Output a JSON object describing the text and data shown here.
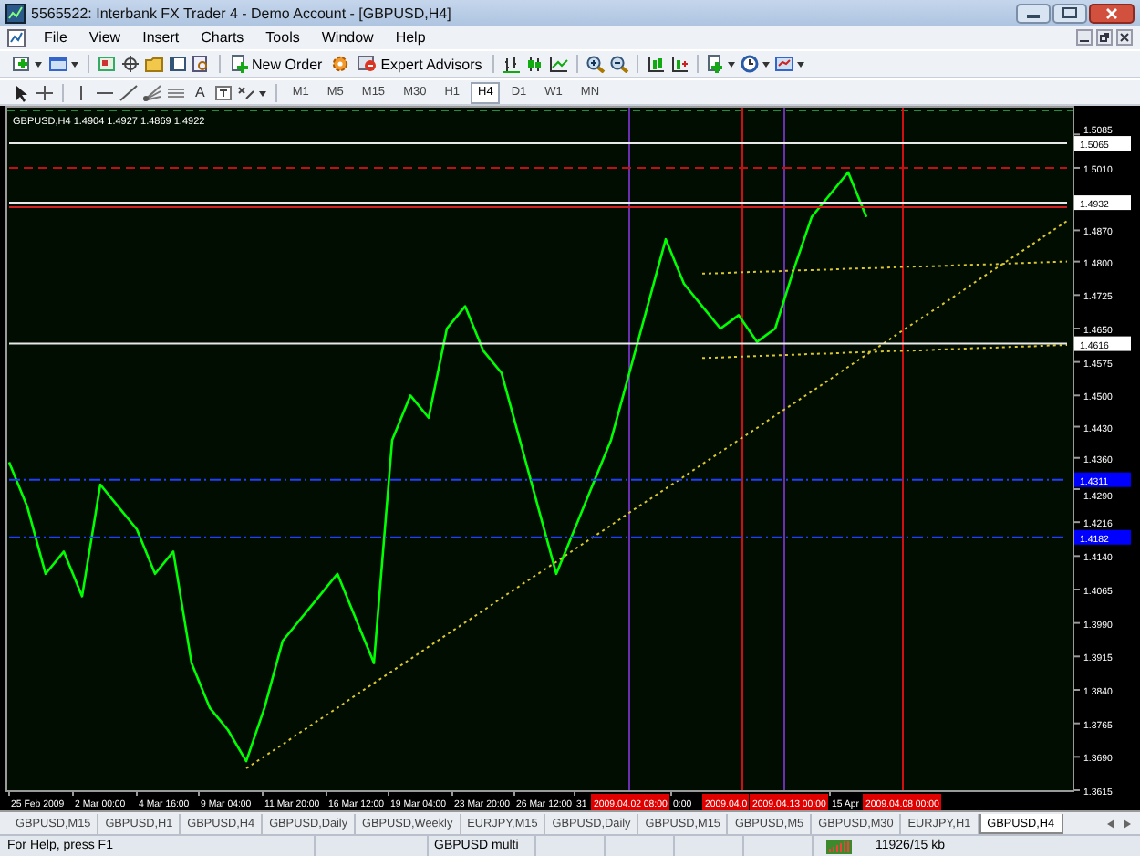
{
  "window": {
    "title": "5565522: Interbank FX Trader 4 - Demo Account - [GBPUSD,H4]"
  },
  "menu": [
    "File",
    "View",
    "Insert",
    "Charts",
    "Tools",
    "Window",
    "Help"
  ],
  "toolbar": {
    "new_order": "New Order",
    "expert_advisors": "Expert Advisors",
    "text_tool": "A"
  },
  "timeframes": [
    {
      "label": "M1",
      "selected": false
    },
    {
      "label": "M5",
      "selected": false
    },
    {
      "label": "M15",
      "selected": false
    },
    {
      "label": "M30",
      "selected": false
    },
    {
      "label": "H1",
      "selected": false
    },
    {
      "label": "H4",
      "selected": true
    },
    {
      "label": "D1",
      "selected": false
    },
    {
      "label": "W1",
      "selected": false
    },
    {
      "label": "MN",
      "selected": false
    }
  ],
  "chart": {
    "quote": "1.4904 1.4927 1.4869 1.4922",
    "price_markers": [
      {
        "label": "1.5065",
        "color": "#ffffff"
      },
      {
        "label": "1.4932",
        "color": "#ffffff"
      },
      {
        "label": "1.4616",
        "color": "#ffffff"
      },
      {
        "label": "1.4311",
        "color": "#0000ff"
      },
      {
        "label": "1.4182",
        "color": "#0000ff"
      }
    ],
    "time_axis": [
      "25 Feb 2009",
      "2 Mar 00:00",
      "4 Mar 16:00",
      "9 Mar 04:00",
      "11 Mar 20:00",
      "16 Mar 12:00",
      "19 Mar 04:00",
      "23 Mar 20:00",
      "26 Mar 12:00",
      "31",
      "0:00",
      "15 Apr"
    ],
    "time_markers": [
      "2009.04.02 08:00",
      "2009.04.0",
      "2009.04.13 00:00",
      "2009.04.08 00:00"
    ],
    "chart_data": {
      "type": "line",
      "ylim": [
        1.3615,
        1.5149
      ],
      "series": [
        {
          "name": "GBPUSD,H4",
          "color": "#00ff00",
          "values": [
            1.435,
            1.425,
            1.41,
            1.415,
            1.405,
            1.43,
            1.425,
            1.42,
            1.41,
            1.415,
            1.39,
            1.38,
            1.375,
            1.368,
            1.38,
            1.395,
            1.4,
            1.405,
            1.41,
            1.4,
            1.39,
            1.44,
            1.45,
            1.445,
            1.465,
            1.47,
            1.46,
            1.455,
            1.44,
            1.425,
            1.41,
            1.42,
            1.43,
            1.44,
            1.455,
            1.47,
            1.485,
            1.475,
            1.47,
            1.465,
            1.468,
            1.462,
            1.465,
            1.478,
            1.49,
            1.495,
            1.5,
            1.49
          ]
        },
        {
          "color": "#d9c631",
          "line_style": "dotted",
          "values": [
            null,
            null,
            null,
            null,
            null,
            null,
            null,
            null,
            null,
            null,
            null,
            null,
            null,
            1.3664,
            1.3691,
            1.3718,
            1.3746,
            1.3773,
            1.38,
            1.3828,
            1.3855,
            1.3882,
            1.3909,
            1.3937,
            1.3964,
            1.3991,
            1.4018,
            1.4046,
            1.4073,
            1.41,
            1.4127,
            1.4155,
            1.4182,
            1.4209,
            1.4237,
            1.4264,
            1.4291,
            1.4318,
            1.4346,
            1.4373,
            1.44,
            1.4427,
            1.4455,
            1.4482,
            1.4509,
            1.4536,
            1.4564,
            1.4591,
            1.4618,
            1.4646,
            1.4673,
            1.47,
            1.4727,
            1.4755,
            1.4782,
            1.4809,
            1.4836,
            1.4864,
            1.4891
          ]
        },
        {
          "color": "#d9c631",
          "line_style": "dotted",
          "values": [
            null,
            null,
            null,
            null,
            null,
            null,
            null,
            null,
            null,
            null,
            null,
            null,
            null,
            null,
            null,
            null,
            null,
            null,
            null,
            null,
            null,
            null,
            null,
            null,
            null,
            null,
            null,
            null,
            null,
            null,
            null,
            null,
            null,
            null,
            null,
            null,
            null,
            null,
            1.4773,
            1.4774,
            1.4776,
            1.4777,
            1.4778,
            1.478,
            1.4781,
            1.4782,
            1.4784,
            1.4785,
            1.4786,
            1.4788,
            1.4789,
            1.479,
            1.4792,
            1.4793,
            1.4794,
            1.4796,
            1.4797,
            1.4799,
            1.48
          ]
        },
        {
          "color": "#d9c631",
          "line_style": "dotted",
          "values": [
            null,
            null,
            null,
            null,
            null,
            null,
            null,
            null,
            null,
            null,
            null,
            null,
            null,
            null,
            null,
            null,
            null,
            null,
            null,
            null,
            null,
            null,
            null,
            null,
            null,
            null,
            null,
            null,
            null,
            null,
            null,
            null,
            null,
            null,
            null,
            null,
            null,
            null,
            1.4584,
            1.4585,
            1.4587,
            1.4588,
            1.459,
            1.4591,
            1.4593,
            1.4594,
            1.4596,
            1.4597,
            1.4599,
            1.46,
            1.4601,
            1.4603,
            1.4604,
            1.4606,
            1.4607,
            1.4609,
            1.461,
            1.4612,
            1.4613
          ]
        },
        {
          "color": "#e8e8e8",
          "line_style": "solid",
          "values": [
            1.5065,
            1.5065,
            1.5065,
            1.5065,
            1.5065,
            1.5065,
            1.5065,
            1.5065,
            1.5065,
            1.5065,
            1.5065,
            1.5065,
            1.5065,
            1.5065,
            1.5065,
            1.5065,
            1.5065,
            1.5065,
            1.5065,
            1.5065,
            1.5065,
            1.5065,
            1.5065,
            1.5065,
            1.5065,
            1.5065,
            1.5065,
            1.5065,
            1.5065,
            1.5065,
            1.5065,
            1.5065,
            1.5065,
            1.5065,
            1.5065,
            1.5065,
            1.5065,
            1.5065,
            1.5065,
            1.5065,
            1.5065,
            1.5065,
            1.5065,
            1.5065,
            1.5065,
            1.5065,
            1.5065,
            1.5065,
            1.5065,
            1.5065,
            1.5065,
            1.5065,
            1.5065,
            1.5065,
            1.5065,
            1.5065,
            1.5065,
            1.5065,
            1.5065
          ]
        },
        {
          "color": "#c01010",
          "line_style": "dashed",
          "values": [
            1.501,
            1.501,
            1.501,
            1.501,
            1.501,
            1.501,
            1.501,
            1.501,
            1.501,
            1.501,
            1.501,
            1.501,
            1.501,
            1.501,
            1.501,
            1.501,
            1.501,
            1.501,
            1.501,
            1.501,
            1.501,
            1.501,
            1.501,
            1.501,
            1.501,
            1.501,
            1.501,
            1.501,
            1.501,
            1.501,
            1.501,
            1.501,
            1.501,
            1.501,
            1.501,
            1.501,
            1.501,
            1.501,
            1.501,
            1.501,
            1.501,
            1.501,
            1.501,
            1.501,
            1.501,
            1.501,
            1.501,
            1.501,
            1.501,
            1.501,
            1.501,
            1.501,
            1.501,
            1.501,
            1.501,
            1.501,
            1.501,
            1.501,
            1.501
          ]
        },
        {
          "color": "#e8e8e8",
          "line_style": "solid",
          "values": [
            1.4932,
            1.4932,
            1.4932,
            1.4932,
            1.4932,
            1.4932,
            1.4932,
            1.4932,
            1.4932,
            1.4932,
            1.4932,
            1.4932,
            1.4932,
            1.4932,
            1.4932,
            1.4932,
            1.4932,
            1.4932,
            1.4932,
            1.4932,
            1.4932,
            1.4932,
            1.4932,
            1.4932,
            1.4932,
            1.4932,
            1.4932,
            1.4932,
            1.4932,
            1.4932,
            1.4932,
            1.4932,
            1.4932,
            1.4932,
            1.4932,
            1.4932,
            1.4932,
            1.4932,
            1.4932,
            1.4932,
            1.4932,
            1.4932,
            1.4932,
            1.4932,
            1.4932,
            1.4932,
            1.4932,
            1.4932,
            1.4932,
            1.4932,
            1.4932,
            1.4932,
            1.4932,
            1.4932,
            1.4932,
            1.4932,
            1.4932,
            1.4932,
            1.4932
          ]
        },
        {
          "color": "#d02020",
          "line_style": "solid",
          "values": [
            1.4922,
            1.4922,
            1.4922,
            1.4922,
            1.4922,
            1.4922,
            1.4922,
            1.4922,
            1.4922,
            1.4922,
            1.4922,
            1.4922,
            1.4922,
            1.4922,
            1.4922,
            1.4922,
            1.4922,
            1.4922,
            1.4922,
            1.4922,
            1.4922,
            1.4922,
            1.4922,
            1.4922,
            1.4922,
            1.4922,
            1.4922,
            1.4922,
            1.4922,
            1.4922,
            1.4922,
            1.4922,
            1.4922,
            1.4922,
            1.4922,
            1.4922,
            1.4922,
            1.4922,
            1.4922,
            1.4922,
            1.4922,
            1.4922,
            1.4922,
            1.4922,
            1.4922,
            1.4922,
            1.4922,
            1.4922,
            1.4922,
            1.4922,
            1.4922,
            1.4922,
            1.4922,
            1.4922,
            1.4922,
            1.4922,
            1.4922,
            1.4922,
            1.4922
          ]
        },
        {
          "color": "#e8e8e8",
          "line_style": "solid",
          "values": [
            1.4616,
            1.4616,
            1.4616,
            1.4616,
            1.4616,
            1.4616,
            1.4616,
            1.4616,
            1.4616,
            1.4616,
            1.4616,
            1.4616,
            1.4616,
            1.4616,
            1.4616,
            1.4616,
            1.4616,
            1.4616,
            1.4616,
            1.4616,
            1.4616,
            1.4616,
            1.4616,
            1.4616,
            1.4616,
            1.4616,
            1.4616,
            1.4616,
            1.4616,
            1.4616,
            1.4616,
            1.4616,
            1.4616,
            1.4616,
            1.4616,
            1.4616,
            1.4616,
            1.4616,
            1.4616,
            1.4616,
            1.4616,
            1.4616,
            1.4616,
            1.4616,
            1.4616,
            1.4616,
            1.4616,
            1.4616,
            1.4616,
            1.4616,
            1.4616,
            1.4616,
            1.4616,
            1.4616,
            1.4616,
            1.4616,
            1.4616,
            1.4616,
            1.4616
          ]
        },
        {
          "color": "#2040ff",
          "line_style": "dashdot",
          "values": [
            1.4311,
            1.4311,
            1.4311,
            1.4311,
            1.4311,
            1.4311,
            1.4311,
            1.4311,
            1.4311,
            1.4311,
            1.4311,
            1.4311,
            1.4311,
            1.4311,
            1.4311,
            1.4311,
            1.4311,
            1.4311,
            1.4311,
            1.4311,
            1.4311,
            1.4311,
            1.4311,
            1.4311,
            1.4311,
            1.4311,
            1.4311,
            1.4311,
            1.4311,
            1.4311,
            1.4311,
            1.4311,
            1.4311,
            1.4311,
            1.4311,
            1.4311,
            1.4311,
            1.4311,
            1.4311,
            1.4311,
            1.4311,
            1.4311,
            1.4311,
            1.4311,
            1.4311,
            1.4311,
            1.4311,
            1.4311,
            1.4311,
            1.4311,
            1.4311,
            1.4311,
            1.4311,
            1.4311,
            1.4311,
            1.4311,
            1.4311,
            1.4311,
            1.4311
          ]
        },
        {
          "color": "#2040ff",
          "line_style": "dashdot",
          "values": [
            1.4182,
            1.4182,
            1.4182,
            1.4182,
            1.4182,
            1.4182,
            1.4182,
            1.4182,
            1.4182,
            1.4182,
            1.4182,
            1.4182,
            1.4182,
            1.4182,
            1.4182,
            1.4182,
            1.4182,
            1.4182,
            1.4182,
            1.4182,
            1.4182,
            1.4182,
            1.4182,
            1.4182,
            1.4182,
            1.4182,
            1.4182,
            1.4182,
            1.4182,
            1.4182,
            1.4182,
            1.4182,
            1.4182,
            1.4182,
            1.4182,
            1.4182,
            1.4182,
            1.4182,
            1.4182,
            1.4182,
            1.4182,
            1.4182,
            1.4182,
            1.4182,
            1.4182,
            1.4182,
            1.4182,
            1.4182,
            1.4182,
            1.4182,
            1.4182,
            1.4182,
            1.4182,
            1.4182,
            1.4182,
            1.4182,
            1.4182,
            1.4182,
            1.4182
          ]
        }
      ],
      "yticks": [
        {
          "value": 1.5085,
          "label": "1.5085"
        },
        {
          "value": 1.501,
          "label": "1.5010"
        },
        {
          "value": 1.487,
          "label": "1.4870"
        },
        {
          "value": 1.48,
          "label": "1.4800"
        },
        {
          "value": 1.4725,
          "label": "1.4725"
        },
        {
          "value": 1.465,
          "label": "1.4650"
        },
        {
          "value": 1.4575,
          "label": "1.4575"
        },
        {
          "value": 1.45,
          "label": "1.4500"
        },
        {
          "value": 1.443,
          "label": "1.4430"
        },
        {
          "value": 1.436,
          "label": "1.4360"
        },
        {
          "value": 1.429,
          "label": "1.4290"
        },
        {
          "value": 1.4216,
          "label": "1.4216"
        },
        {
          "value": 1.414,
          "label": "1.4140"
        },
        {
          "value": 1.4065,
          "label": "1.4065"
        },
        {
          "value": 1.399,
          "label": "1.3990"
        },
        {
          "value": 1.3915,
          "label": "1.3915"
        },
        {
          "value": 1.384,
          "label": "1.3840"
        },
        {
          "value": 1.3765,
          "label": "1.3765"
        },
        {
          "value": 1.369,
          "label": "1.3690"
        },
        {
          "value": 1.3615,
          "label": "1.3615"
        }
      ]
    }
  },
  "tabs": [
    {
      "label": "GBPUSD,M15",
      "selected": false
    },
    {
      "label": "GBPUSD,H1",
      "selected": false
    },
    {
      "label": "GBPUSD,H4",
      "selected": false
    },
    {
      "label": "GBPUSD,Daily",
      "selected": false
    },
    {
      "label": "GBPUSD,Weekly",
      "selected": false
    },
    {
      "label": "EURJPY,M15",
      "selected": false
    },
    {
      "label": "GBPUSD,Daily",
      "selected": false
    },
    {
      "label": "GBPUSD,M15",
      "selected": false
    },
    {
      "label": "GBPUSD,M5",
      "selected": false
    },
    {
      "label": "GBPUSD,M30",
      "selected": false
    },
    {
      "label": "EURJPY,H1",
      "selected": false
    },
    {
      "label": "GBPUSD,H4",
      "selected": true
    }
  ],
  "status_bar": {
    "help": "For Help, press F1",
    "profile": "GBPUSD multi",
    "traffic": "11926/15 kb"
  }
}
